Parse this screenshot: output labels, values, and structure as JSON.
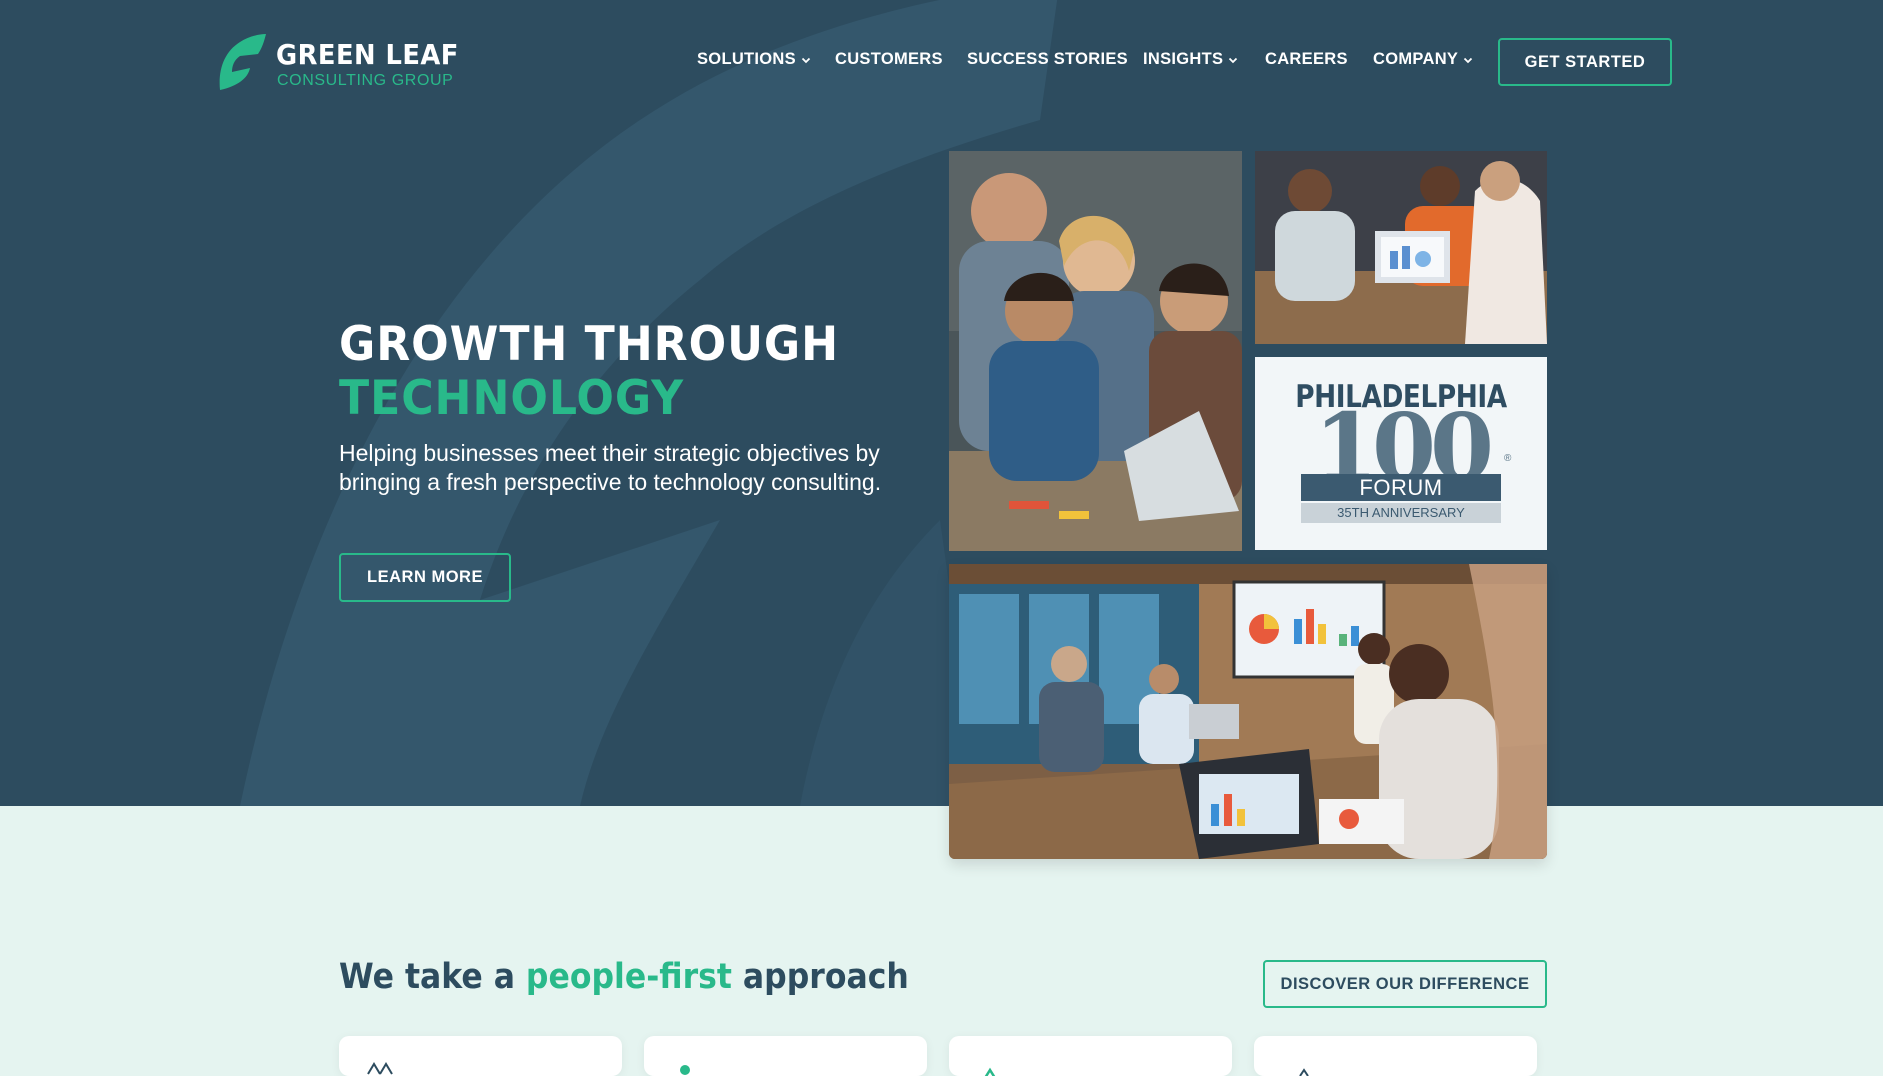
{
  "brand": {
    "name": "GREEN LEAF",
    "subtitle": "CONSULTING GROUP",
    "accent_color": "#29b98a",
    "primary_color": "#2d4c5f"
  },
  "nav": {
    "items": [
      {
        "label": "SOLUTIONS",
        "has_dropdown": true
      },
      {
        "label": "CUSTOMERS",
        "has_dropdown": false
      },
      {
        "label": "SUCCESS STORIES",
        "has_dropdown": false
      },
      {
        "label": "INSIGHTS",
        "has_dropdown": true
      },
      {
        "label": "CAREERS",
        "has_dropdown": false
      },
      {
        "label": "COMPANY",
        "has_dropdown": true
      }
    ],
    "cta": "GET STARTED"
  },
  "hero": {
    "headline_line1": "GROWTH THROUGH",
    "headline_line2": "TECHNOLOGY",
    "subtext": "Helping businesses meet their strategic objectives by bringing a fresh perspective to technology consulting.",
    "button": "LEARN MORE",
    "photos": [
      {
        "icon": "team-collaborating-laptop-photo"
      },
      {
        "icon": "team-meeting-laptop-photo"
      },
      {
        "icon": "philadelphia-100-forum-badge"
      },
      {
        "icon": "conference-room-presentation-photo"
      }
    ],
    "award": {
      "title": "PHILADELPHIA",
      "number": "100",
      "label": "FORUM",
      "anniversary": "35TH ANNIVERSARY",
      "registered": "®"
    }
  },
  "approach": {
    "heading_pre": "We take a ",
    "heading_accent": "people-first",
    "heading_post": " approach",
    "button": "DISCOVER OUR DIFFERENCE"
  },
  "cards": [
    {
      "icon": "people-icon"
    },
    {
      "icon": "person-icon"
    },
    {
      "icon": "growth-icon"
    },
    {
      "icon": "leaf-icon"
    }
  ]
}
